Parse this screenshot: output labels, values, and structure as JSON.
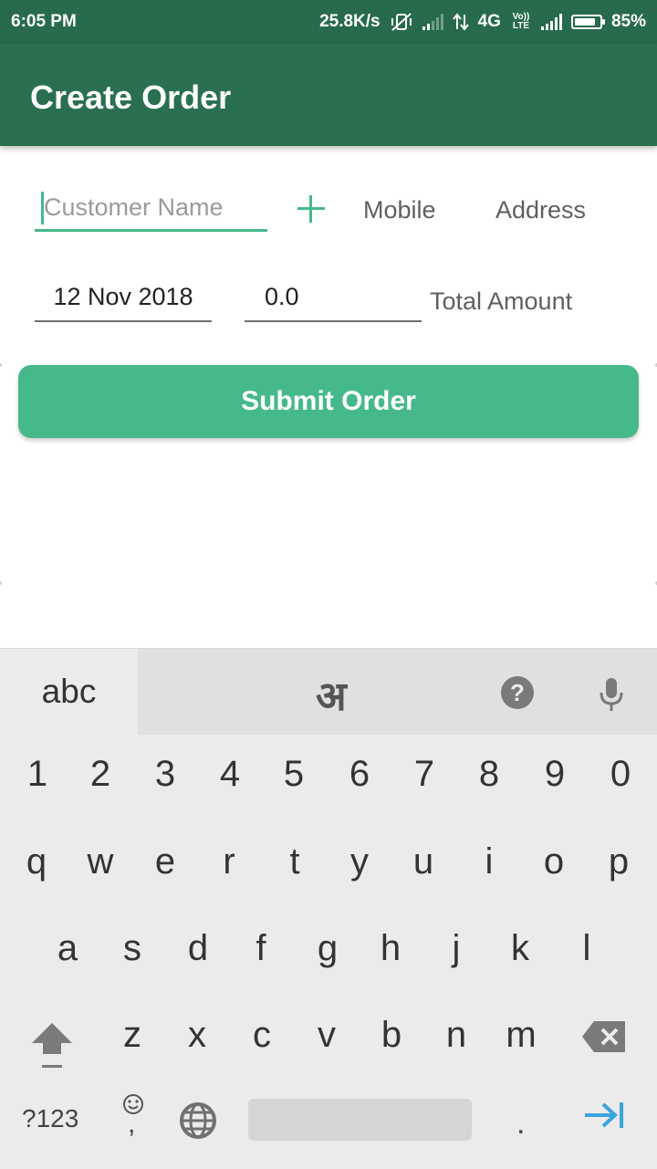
{
  "status_bar": {
    "time": "6:05 PM",
    "speed": "25.8K/s",
    "network": "4G",
    "volte": "Vo)) LTE",
    "battery": "85%",
    "battery_level": 0.85
  },
  "app_bar": {
    "title": "Create Order"
  },
  "form": {
    "customer_placeholder": "Customer Name",
    "mobile_label": "Mobile",
    "address_label": "Address",
    "date_value": "12 Nov 2018",
    "amount_value": "0.0",
    "total_label": "Total Amount",
    "submit_label": "Submit Order"
  },
  "colors": {
    "primary": "#2a6f4f",
    "accent": "#46b98a"
  },
  "keyboard": {
    "mode_label": "abc",
    "hindi_label": "अ",
    "numbers": [
      "1",
      "2",
      "3",
      "4",
      "5",
      "6",
      "7",
      "8",
      "9",
      "0"
    ],
    "row1": [
      "q",
      "w",
      "e",
      "r",
      "t",
      "y",
      "u",
      "i",
      "o",
      "p"
    ],
    "row2": [
      "a",
      "s",
      "d",
      "f",
      "g",
      "h",
      "j",
      "k",
      "l"
    ],
    "row3": [
      "z",
      "x",
      "c",
      "v",
      "b",
      "n",
      "m"
    ],
    "symbols_label": "?123",
    "period_label": ".",
    "comma_label": ",",
    "help_label": "?",
    "icons": [
      "help-icon",
      "mic-icon",
      "shift-icon",
      "backspace-icon",
      "emoji-icon",
      "globe-icon",
      "enter-icon"
    ]
  }
}
